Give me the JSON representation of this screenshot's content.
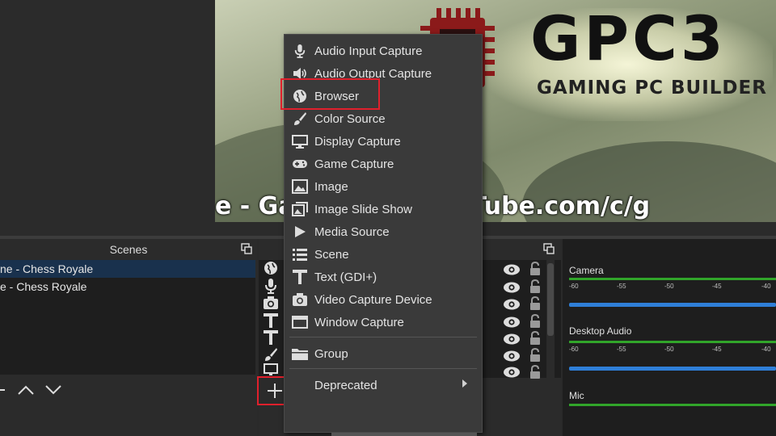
{
  "preview": {
    "logo_text": "GPC3",
    "logo_subtitle": "GAMING PC BUILDER",
    "ticker_text": "e - Gam                    .com - YouTube.com/c/g"
  },
  "scenes": {
    "title": "Scenes",
    "items": [
      {
        "label": "ne - Chess Royale",
        "selected": true
      },
      {
        "label": "e - Chess Royale",
        "selected": false
      }
    ]
  },
  "sources": {
    "rows": [
      {
        "icon": "globe-icon"
      },
      {
        "icon": "microphone-icon"
      },
      {
        "icon": "camera-icon"
      },
      {
        "icon": "text-icon"
      },
      {
        "icon": "text-icon"
      },
      {
        "icon": "brush-icon"
      },
      {
        "icon": "display-icon"
      }
    ],
    "add_label": "+"
  },
  "context_menu": {
    "items": [
      {
        "label": "Audio Input Capture",
        "icon": "microphone-icon"
      },
      {
        "label": "Audio Output Capture",
        "icon": "speaker-icon"
      },
      {
        "label": "Browser",
        "icon": "globe-icon"
      },
      {
        "label": "Color Source",
        "icon": "brush-icon"
      },
      {
        "label": "Display Capture",
        "icon": "monitor-icon"
      },
      {
        "label": "Game Capture",
        "icon": "gamepad-icon"
      },
      {
        "label": "Image",
        "icon": "image-icon"
      },
      {
        "label": "Image Slide Show",
        "icon": "slideshow-icon"
      },
      {
        "label": "Media Source",
        "icon": "play-icon"
      },
      {
        "label": "Scene",
        "icon": "list-icon"
      },
      {
        "label": "Text (GDI+)",
        "icon": "text-icon"
      },
      {
        "label": "Video Capture Device",
        "icon": "camera-icon"
      },
      {
        "label": "Window Capture",
        "icon": "window-icon"
      }
    ],
    "group_label": "Group",
    "deprecated_label": "Deprecated"
  },
  "mixer": {
    "channels": [
      {
        "name": "Camera"
      },
      {
        "name": "Desktop Audio"
      },
      {
        "name": "Mic"
      }
    ],
    "ticks": [
      "-60",
      "-55",
      "-50",
      "-45",
      "-40"
    ]
  },
  "colors": {
    "highlight_box": "#e0202c",
    "meter_green": "#31a52a",
    "fader_blue": "#2f7fd8",
    "selection_blue": "#19314d"
  }
}
